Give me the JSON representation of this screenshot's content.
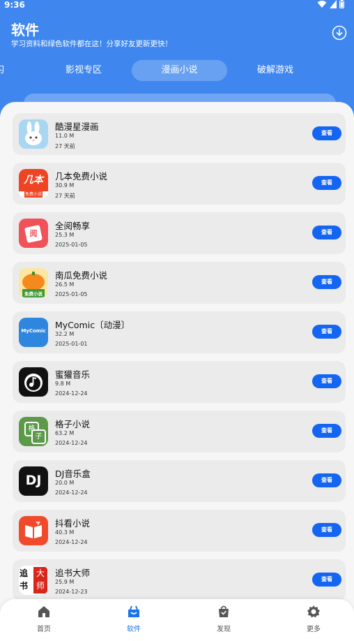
{
  "status": {
    "time": "9:36"
  },
  "header": {
    "title": "软件",
    "subtitle": "学习资料和绿色软件都在这！分享好友更新更快！"
  },
  "tabs": [
    {
      "label": "习"
    },
    {
      "label": "影视专区"
    },
    {
      "label": "漫画小说",
      "active": true
    },
    {
      "label": "破解游戏"
    }
  ],
  "apps": [
    {
      "name": "酷漫星漫画",
      "size": "11.0 M",
      "date": "27 天前",
      "icon": "bunny-icon",
      "button": "查看"
    },
    {
      "name": "几本免费小说",
      "size": "30.9 M",
      "date": "27 天前",
      "icon": "jiben-icon",
      "icon_text": "几本",
      "icon_sub": "免费小说",
      "button": "查看"
    },
    {
      "name": "全阅畅享",
      "size": "25.3 M",
      "date": "2025-01-05",
      "icon": "book-icon",
      "icon_text": "阅",
      "button": "查看"
    },
    {
      "name": "南瓜免费小说",
      "size": "26.5 M",
      "date": "2025-01-05",
      "icon": "pumpkin-icon",
      "icon_sub": "免费小说",
      "button": "查看"
    },
    {
      "name": "MyComic〔动漫〕",
      "size": "32.2 M",
      "date": "2025-01-01",
      "icon": "mycomic-icon",
      "icon_text": "MyComic",
      "button": "查看"
    },
    {
      "name": "蜜獾音乐",
      "size": "9.8 M",
      "date": "2024-12-24",
      "icon": "music-note-icon",
      "button": "查看"
    },
    {
      "name": "格子小说",
      "size": "63.2 M",
      "date": "2024-12-24",
      "icon": "gezi-icon",
      "icon_text": "格",
      "icon_sub": "子",
      "button": "查看"
    },
    {
      "name": "DJ音乐盒",
      "size": "20.0 M",
      "date": "2024-12-24",
      "icon": "dj-icon",
      "icon_text": "DJ",
      "button": "查看"
    },
    {
      "name": "抖看小说",
      "size": "40.3 M",
      "date": "2024-12-24",
      "icon": "open-book-icon",
      "button": "查看"
    },
    {
      "name": "追书大师",
      "size": "25.9 M",
      "date": "2024-12-23",
      "icon": "zhuishu-icon",
      "icon_text": "追书",
      "icon_sub": "大师",
      "button": "查看"
    }
  ],
  "nav": [
    {
      "label": "首页",
      "icon": "home-icon"
    },
    {
      "label": "软件",
      "icon": "software-icon",
      "active": true
    },
    {
      "label": "发现",
      "icon": "bag-icon"
    },
    {
      "label": "更多",
      "icon": "gear-icon"
    }
  ],
  "colors": {
    "primary": "#3f87ef",
    "button": "#1565f3",
    "nav_active": "#1a73e8"
  }
}
